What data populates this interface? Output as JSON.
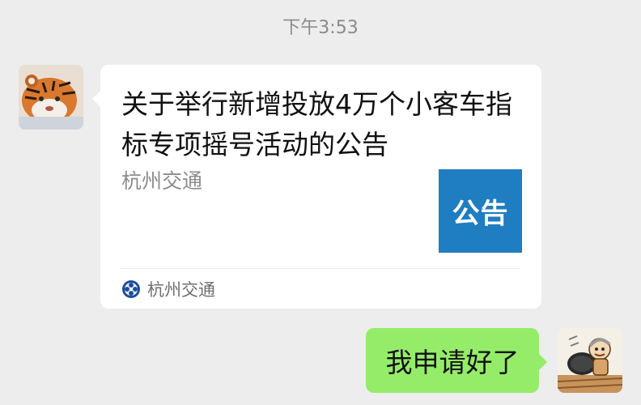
{
  "timestamp": "下午3:53",
  "incoming_message": {
    "avatar_icon": "tiger-avatar",
    "article": {
      "title": "关于举行新增投放4万个小客车指标专项摇号活动的公告",
      "source": "杭州交通",
      "thumbnail_text": "公告",
      "thumbnail_color": "#1f7dc2",
      "account_icon": "official-account-logo-icon",
      "account_name": "杭州交通"
    }
  },
  "outgoing_message": {
    "avatar_icon": "cartoon-character-avatar",
    "text": "我申请好了",
    "bubble_color": "#95ec69"
  }
}
